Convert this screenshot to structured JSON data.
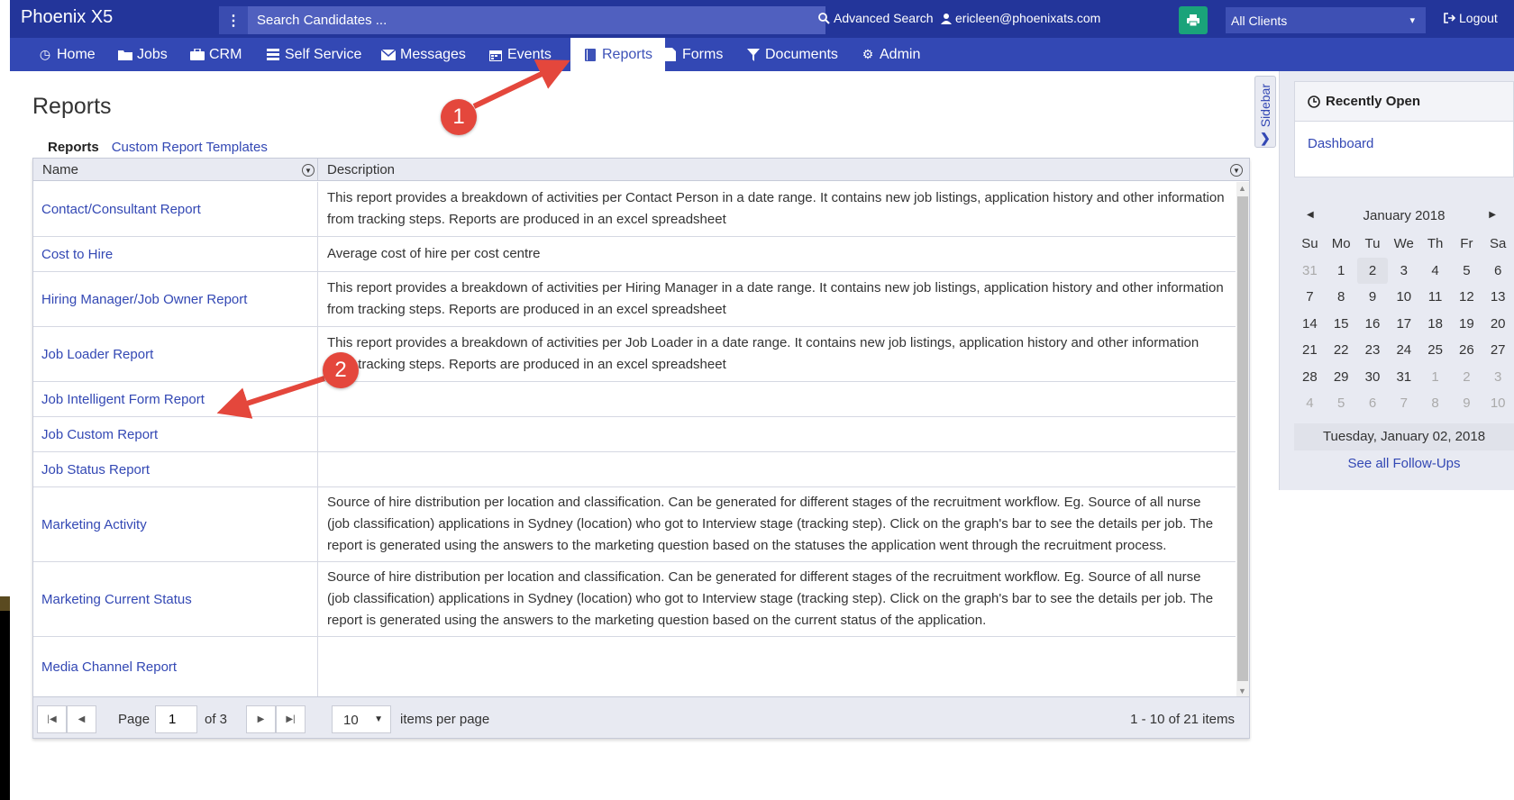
{
  "app": {
    "brand": "Phoenix X5"
  },
  "topbar": {
    "search_placeholder": "Search Candidates ...",
    "advanced_search": "Advanced Search",
    "user_email": "ericleen@phoenixats.com",
    "clients_select": "All Clients",
    "logout": "Logout"
  },
  "nav": {
    "items": [
      {
        "label": "Home",
        "icon": "home-icon"
      },
      {
        "label": "Jobs",
        "icon": "folder-icon"
      },
      {
        "label": "CRM",
        "icon": "briefcase-icon"
      },
      {
        "label": "Self Service",
        "icon": "list-icon"
      },
      {
        "label": "Messages",
        "icon": "envelope-icon"
      },
      {
        "label": "Events",
        "icon": "calendar-icon"
      },
      {
        "label": "Reports",
        "icon": "book-icon",
        "active": true
      },
      {
        "label": "Forms",
        "icon": "file-icon"
      },
      {
        "label": "Documents",
        "icon": "filter-icon"
      },
      {
        "label": "Admin",
        "icon": "gear-icon"
      }
    ]
  },
  "main": {
    "title": "Reports",
    "subtabs": {
      "active": "Reports",
      "link": "Custom Report Templates"
    },
    "grid": {
      "columns": [
        "Name",
        "Description"
      ],
      "rows": [
        {
          "name": "Contact/Consultant Report",
          "description": "This report provides a breakdown of activities per Contact Person in a date range. It contains new job listings, application history and other information from tracking steps. Reports are produced in an excel spreadsheet"
        },
        {
          "name": "Cost to Hire",
          "description": "Average cost of hire per cost centre"
        },
        {
          "name": "Hiring Manager/Job Owner Report",
          "description": "This report provides a breakdown of activities per Hiring Manager in a date range. It contains new job listings, application history and other information from tracking steps. Reports are produced in an excel spreadsheet"
        },
        {
          "name": "Job Loader Report",
          "description": "This report provides a breakdown of activities per Job Loader in a date range. It contains new job listings, application history and other information from tracking steps. Reports are produced in an excel spreadsheet"
        },
        {
          "name": "Job Intelligent Form Report",
          "description": ""
        },
        {
          "name": "Job Custom Report",
          "description": ""
        },
        {
          "name": "Job Status Report",
          "description": ""
        },
        {
          "name": "Marketing Activity",
          "description": "Source of hire distribution per location and classification. Can be generated for different stages of the recruitment workflow. Eg. Source of all nurse (job classification) applications in Sydney (location) who got to Interview stage (tracking step). Click on the graph's bar to see the details per job. The report is generated using the answers to the marketing question based on the statuses the application went through the recruitment process."
        },
        {
          "name": "Marketing Current Status",
          "description": "Source of hire distribution per location and classification. Can be generated for different stages of the recruitment workflow. Eg. Source of all nurse (job classification) applications in Sydney (location) who got to Interview stage (tracking step). Click on the graph's bar to see the details per job. The report is generated using the answers to the marketing question based on the current status of the application."
        },
        {
          "name": "Media Channel Report",
          "description": ""
        }
      ]
    },
    "pager": {
      "page_label": "Page",
      "page_value": "1",
      "of_label": "of 3",
      "page_size": "10",
      "items_per_page": "items per page",
      "summary": "1 - 10 of 21 items"
    }
  },
  "sidebar": {
    "tab_label": "Sidebar",
    "recently_open_title": "Recently Open",
    "recent_items": [
      "Dashboard"
    ],
    "calendar": {
      "month_title": "January 2018",
      "weekdays": [
        "Su",
        "Mo",
        "Tu",
        "We",
        "Th",
        "Fr",
        "Sa"
      ],
      "weeks": [
        [
          "31",
          "1",
          "2",
          "3",
          "4",
          "5",
          "6"
        ],
        [
          "7",
          "8",
          "9",
          "10",
          "11",
          "12",
          "13"
        ],
        [
          "14",
          "15",
          "16",
          "17",
          "18",
          "19",
          "20"
        ],
        [
          "21",
          "22",
          "23",
          "24",
          "25",
          "26",
          "27"
        ],
        [
          "28",
          "29",
          "30",
          "31",
          "1",
          "2",
          "3"
        ],
        [
          "4",
          "5",
          "6",
          "7",
          "8",
          "9",
          "10"
        ]
      ],
      "selected_date": "2",
      "footer": "Tuesday, January 02, 2018"
    },
    "follow_ups_link": "See all Follow-Ups"
  },
  "annotations": {
    "step1": "1",
    "step2": "2",
    "color": "#e4473c"
  },
  "colors": {
    "header": "#23359a",
    "nav": "#3348b4",
    "link": "#3348b4",
    "print_button": "#1aa37a"
  }
}
